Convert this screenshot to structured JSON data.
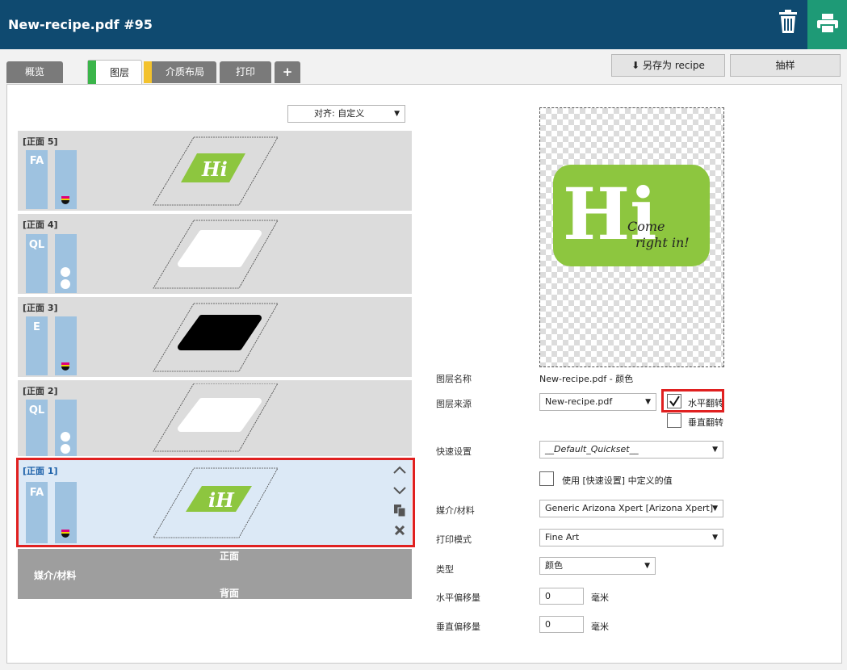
{
  "window": {
    "title": "New-recipe.pdf #95"
  },
  "tabs": [
    {
      "label": "概览"
    },
    {
      "label": "图层",
      "color": "#3bb54a"
    },
    {
      "label": "介质布局",
      "color": "#f3c22d"
    },
    {
      "label": "打印"
    },
    {
      "label": "+"
    }
  ],
  "toolbar": {
    "save_as_recipe": "另存为 recipe",
    "sample": "抽样"
  },
  "align": {
    "value": "对齐: 自定义"
  },
  "layers": [
    {
      "label": "[正面 5]",
      "mode": "FA",
      "preview": "Hi"
    },
    {
      "label": "[正面 4]",
      "mode": "QL"
    },
    {
      "label": "[正面 3]",
      "mode": "E"
    },
    {
      "label": "[正面 2]",
      "mode": "QL"
    },
    {
      "label": "[正面 1]",
      "mode": "FA",
      "preview": "iH"
    }
  ],
  "media_bar": {
    "front": "正面",
    "media": "媒介/材料",
    "back": "背面"
  },
  "preview_logo": {
    "text": "Hi",
    "script": "Come\nright in!",
    "color": "#8dc63f"
  },
  "form": {
    "layer_name_label": "图层名称",
    "layer_name_value": "New-recipe.pdf - 颜色",
    "layer_source_label": "图层来源",
    "layer_source_value": "New-recipe.pdf",
    "flip_h_label": "水平翻转",
    "flip_v_label": "垂直翻转",
    "quickset_label": "快速设置",
    "quickset_value": "__Default_Quickset__",
    "use_quickset_label": "使用 [快速设置] 中定义的值",
    "media_label": "媒介/材料",
    "media_value": "Generic Arizona Xpert [Arizona Xpert]",
    "print_mode_label": "打印模式",
    "print_mode_value": "Fine Art",
    "type_label": "类型",
    "type_value": "颜色",
    "h_offset_label": "水平偏移量",
    "h_offset_value": "0",
    "v_offset_label": "垂直偏移量",
    "v_offset_value": "0",
    "unit": "毫米"
  }
}
